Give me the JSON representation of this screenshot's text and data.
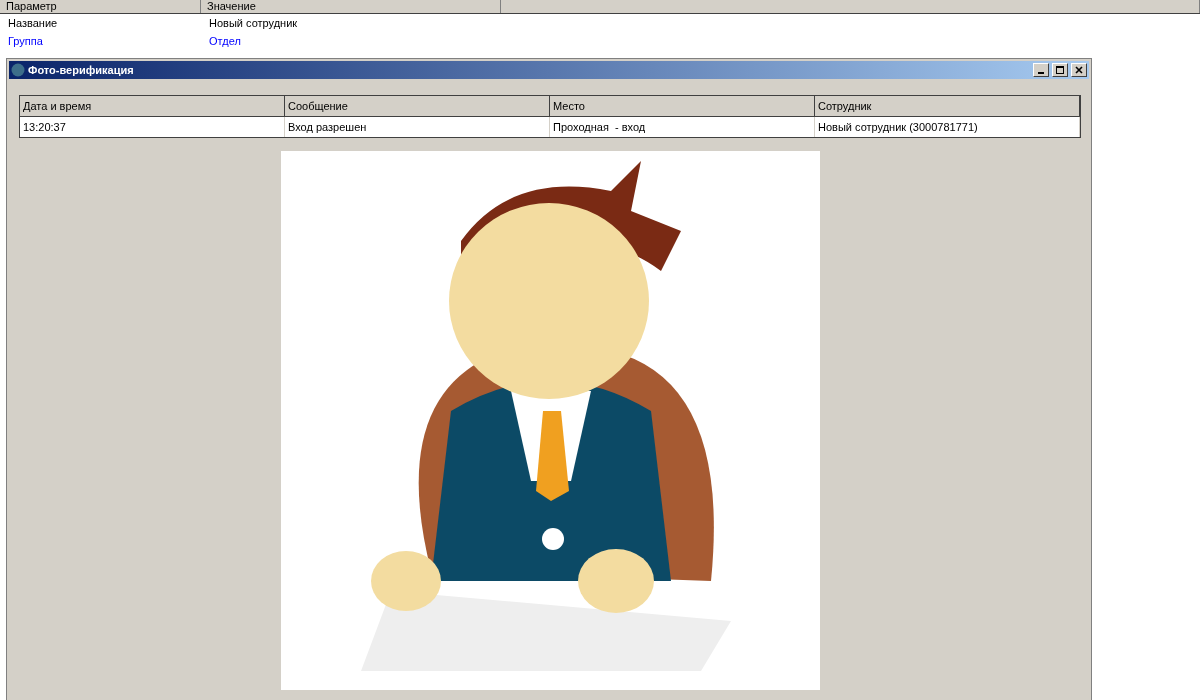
{
  "properties": {
    "columns": [
      "Параметр",
      "Значение"
    ],
    "rows": [
      {
        "name": "Название",
        "value": "Новый сотрудник",
        "kind": "plain"
      },
      {
        "name": "Группа",
        "value": "Отдел",
        "kind": "link"
      }
    ]
  },
  "window": {
    "title": "Фото-верификация",
    "table": {
      "columns": [
        "Дата и время",
        "Сообщение",
        "Место",
        "Сотрудник"
      ],
      "rows": [
        {
          "cells": [
            "13:20:37",
            "Вход разрешен",
            "Проходная  - вход",
            "Новый сотрудник (3000781771)"
          ]
        }
      ]
    }
  }
}
